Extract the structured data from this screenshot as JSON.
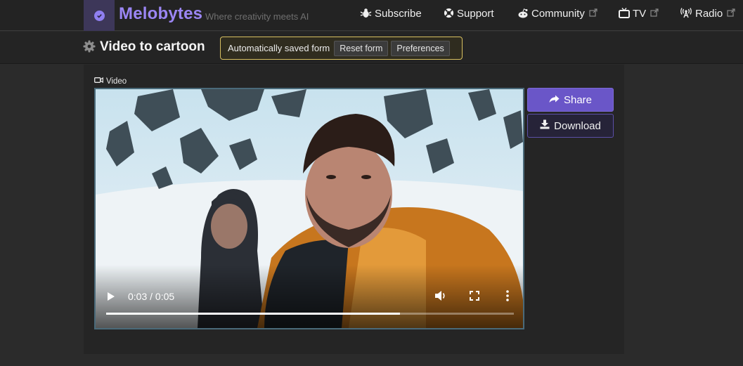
{
  "nav": {
    "brand": "Melobytes",
    "tagline": "Where creativity meets AI",
    "items": [
      {
        "label": "Subscribe",
        "icon": "bug-icon"
      },
      {
        "label": "Support",
        "icon": "lifebuoy-icon"
      },
      {
        "label": "Community",
        "icon": "reddit-icon",
        "external": true
      },
      {
        "label": "TV",
        "icon": "tv-icon",
        "external": true
      },
      {
        "label": "Radio",
        "icon": "radio-tower-icon",
        "external": true
      }
    ]
  },
  "page": {
    "title": "Video to cartoon",
    "saved_text": "Automatically saved form",
    "reset_label": "Reset form",
    "preferences_label": "Preferences"
  },
  "video": {
    "label": "Video",
    "time": "0:03 / 0:05",
    "progress": 0.72
  },
  "actions": {
    "share_label": "Share",
    "download_label": "Download"
  },
  "colors": {
    "brand": "#9b86f4",
    "accent": "#6a56c8",
    "saved_border": "#d8c060"
  }
}
